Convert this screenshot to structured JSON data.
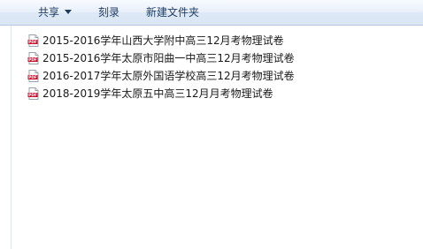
{
  "toolbar": {
    "share_label": "共享",
    "burn_label": "刻录",
    "new_folder_label": "新建文件夹"
  },
  "files": [
    {
      "name": "2015-2016学年山西大学附中高三12月考物理试卷",
      "icon": "pdf-icon"
    },
    {
      "name": "2015-2016学年太原市阳曲一中高三12月考物理试卷",
      "icon": "pdf-icon"
    },
    {
      "name": "2016-2017学年太原外国语学校高三12月考物理试卷",
      "icon": "pdf-icon"
    },
    {
      "name": "2018-2019学年太原五中高三12月月考物理试卷",
      "icon": "pdf-icon"
    }
  ],
  "colors": {
    "toolbar_text": "#1e3a5f",
    "pdf_red": "#c8102e"
  }
}
